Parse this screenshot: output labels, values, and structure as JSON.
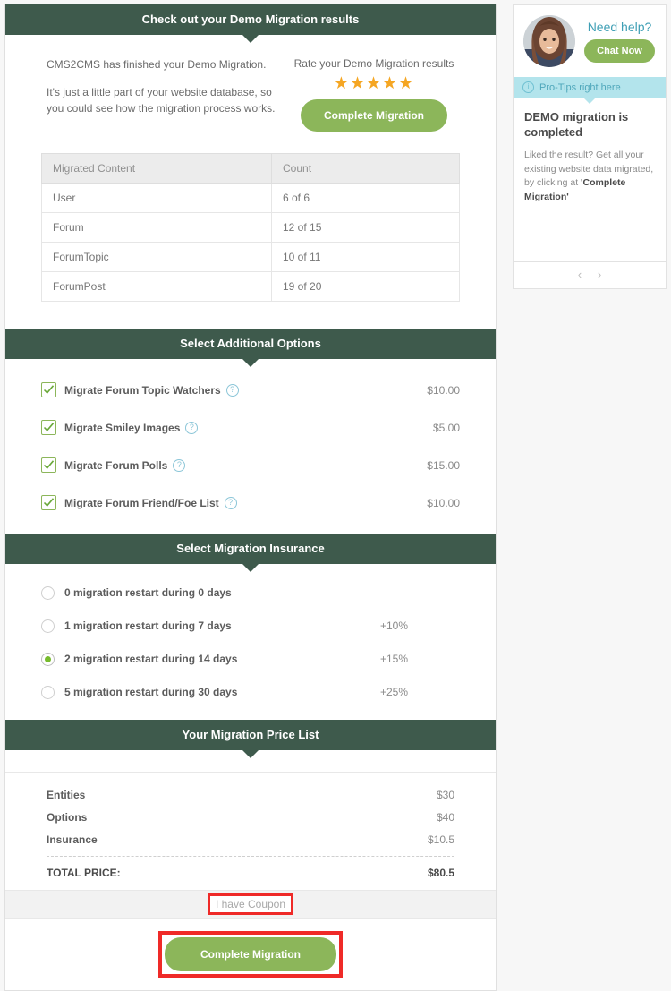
{
  "results": {
    "header": "Check out your Demo Migration results",
    "paragraphs": [
      "CMS2CMS has finished your Demo Migration.",
      "It's just a little part of your website database, so you could see how the migration process works."
    ],
    "rate_label": "Rate your Demo Migration results",
    "stars": "★★★★★",
    "star_color": "#f5a623",
    "complete_button": "Complete Migration",
    "table": {
      "columns": [
        "Migrated Content",
        "Count"
      ],
      "rows": [
        [
          "User",
          "6 of 6"
        ],
        [
          "Forum",
          "12 of 15"
        ],
        [
          "ForumTopic",
          "10 of 11"
        ],
        [
          "ForumPost",
          "19 of 20"
        ]
      ]
    }
  },
  "options": {
    "header": "Select Additional Options",
    "help_icon": "?",
    "items": [
      {
        "label": "Migrate Forum Topic Watchers",
        "price": "$10.00",
        "checked": true
      },
      {
        "label": "Migrate Smiley Images",
        "price": "$5.00",
        "checked": true
      },
      {
        "label": "Migrate Forum Polls",
        "price": "$15.00",
        "checked": true
      },
      {
        "label": "Migrate Forum Friend/Foe List",
        "price": "$10.00",
        "checked": true
      }
    ]
  },
  "insurance": {
    "header": "Select Migration Insurance",
    "items": [
      {
        "label": "0 migration restart during 0 days",
        "price": "",
        "selected": false
      },
      {
        "label": "1 migration restart during 7 days",
        "price": "+10%",
        "selected": false
      },
      {
        "label": "2 migration restart during 14 days",
        "price": "+15%",
        "selected": true
      },
      {
        "label": "5 migration restart during 30 days",
        "price": "+25%",
        "selected": false
      }
    ]
  },
  "price_list": {
    "header": "Your Migration Price List",
    "rows": [
      {
        "name": "Entities",
        "value": "$30"
      },
      {
        "name": "Options",
        "value": "$40"
      },
      {
        "name": "Insurance",
        "value": "$10.5"
      }
    ],
    "total_label": "TOTAL PRICE:",
    "total_value": "$80.5"
  },
  "footer": {
    "coupon_link": "I have Coupon",
    "complete_button": "Complete Migration",
    "highlight_color": "#ef2a28"
  },
  "sidebar": {
    "need_help": "Need help?",
    "chat_button": "Chat Now",
    "protips_label": "Pro-Tips right here",
    "info_icon": "i",
    "tip_title": "DEMO migration is completed",
    "tip_text_start": "Liked the result? Get all your existing website data migrated, by clicking at ",
    "tip_text_bold": "'Complete Migration'",
    "prev_icon": "‹",
    "next_icon": "›"
  },
  "theme": {
    "header_green": "#3e5a4c",
    "button_green": "#8cb65a",
    "teal": "#3f9fb5",
    "protip_bg": "#b3e4ec"
  }
}
